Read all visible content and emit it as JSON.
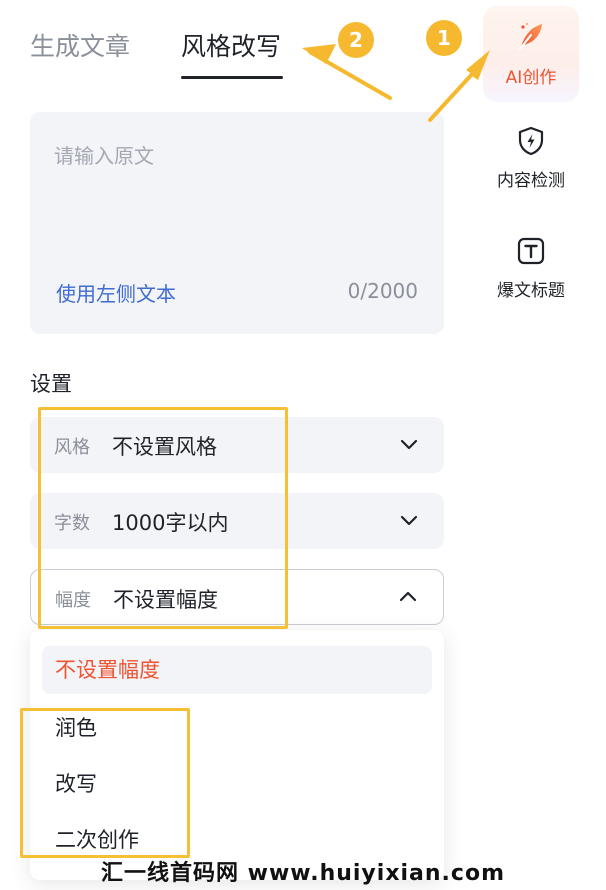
{
  "tabs": [
    {
      "label": "生成文章",
      "active": false
    },
    {
      "label": "风格改写",
      "active": true
    }
  ],
  "sidebar": {
    "items": [
      {
        "label": "AI创作",
        "icon": "feather-pen-icon",
        "active": true
      },
      {
        "label": "内容检测",
        "icon": "shield-bolt-icon"
      },
      {
        "label": "爆文标题",
        "icon": "text-t-icon"
      }
    ]
  },
  "input": {
    "placeholder": "请输入原文",
    "value": "",
    "use_left_text": "使用左侧文本",
    "counter": "0/2000"
  },
  "settings": {
    "title": "设置",
    "rows": [
      {
        "key": "风格",
        "value": "不设置风格",
        "expanded": false
      },
      {
        "key": "字数",
        "value": "1000字以内",
        "expanded": false
      },
      {
        "key": "幅度",
        "value": "不设置幅度",
        "expanded": true
      }
    ],
    "range_options": [
      "不设置幅度",
      "润色",
      "改写",
      "二次创作"
    ],
    "range_selected": "不设置幅度"
  },
  "annotations": {
    "badge_1": "1",
    "badge_2": "2",
    "color": "#f5c033"
  },
  "watermark": "汇一线首码网 www.huiyixian.com",
  "colors": {
    "accent": "#f0532f",
    "link": "#3f6bd2",
    "panel_bg": "#f3f4f8"
  }
}
